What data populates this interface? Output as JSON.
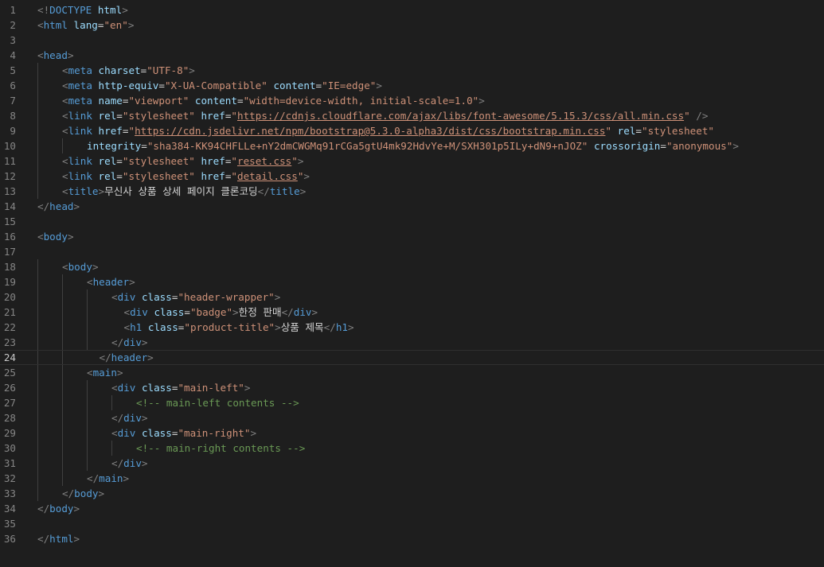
{
  "theme": {
    "background": "#1e1e1e",
    "line_number": "#858585",
    "tag": "#569cd6",
    "attribute": "#9cdcfe",
    "string": "#ce9178",
    "text": "#d4d4d4",
    "comment": "#6a9955",
    "punctuation": "#808080"
  },
  "editor": {
    "active_line": 24,
    "lines": [
      {
        "n": 1,
        "indent": 0,
        "tokens": [
          [
            "p",
            "<!"
          ],
          [
            "t",
            "DOCTYPE"
          ],
          [
            "x",
            " "
          ],
          [
            "a",
            "html"
          ],
          [
            "p",
            ">"
          ]
        ]
      },
      {
        "n": 2,
        "indent": 0,
        "tokens": [
          [
            "p",
            "<"
          ],
          [
            "t",
            "html"
          ],
          [
            "x",
            " "
          ],
          [
            "a",
            "lang"
          ],
          [
            "x",
            "="
          ],
          [
            "s",
            "\"en\""
          ],
          [
            "p",
            ">"
          ]
        ]
      },
      {
        "n": 3,
        "indent": 0,
        "tokens": []
      },
      {
        "n": 4,
        "indent": 0,
        "tokens": [
          [
            "p",
            "<"
          ],
          [
            "t",
            "head"
          ],
          [
            "p",
            ">"
          ]
        ]
      },
      {
        "n": 5,
        "indent": 1,
        "tokens": [
          [
            "p",
            "<"
          ],
          [
            "t",
            "meta"
          ],
          [
            "x",
            " "
          ],
          [
            "a",
            "charset"
          ],
          [
            "x",
            "="
          ],
          [
            "s",
            "\"UTF-8\""
          ],
          [
            "p",
            ">"
          ]
        ]
      },
      {
        "n": 6,
        "indent": 1,
        "tokens": [
          [
            "p",
            "<"
          ],
          [
            "t",
            "meta"
          ],
          [
            "x",
            " "
          ],
          [
            "a",
            "http-equiv"
          ],
          [
            "x",
            "="
          ],
          [
            "s",
            "\"X-UA-Compatible\""
          ],
          [
            "x",
            " "
          ],
          [
            "a",
            "content"
          ],
          [
            "x",
            "="
          ],
          [
            "s",
            "\"IE=edge\""
          ],
          [
            "p",
            ">"
          ]
        ]
      },
      {
        "n": 7,
        "indent": 1,
        "tokens": [
          [
            "p",
            "<"
          ],
          [
            "t",
            "meta"
          ],
          [
            "x",
            " "
          ],
          [
            "a",
            "name"
          ],
          [
            "x",
            "="
          ],
          [
            "s",
            "\"viewport\""
          ],
          [
            "x",
            " "
          ],
          [
            "a",
            "content"
          ],
          [
            "x",
            "="
          ],
          [
            "s",
            "\"width=device-width, initial-scale=1.0\""
          ],
          [
            "p",
            ">"
          ]
        ]
      },
      {
        "n": 8,
        "indent": 1,
        "tokens": [
          [
            "p",
            "<"
          ],
          [
            "t",
            "link"
          ],
          [
            "x",
            " "
          ],
          [
            "a",
            "rel"
          ],
          [
            "x",
            "="
          ],
          [
            "s",
            "\"stylesheet\""
          ],
          [
            "x",
            " "
          ],
          [
            "a",
            "href"
          ],
          [
            "x",
            "="
          ],
          [
            "s",
            "\""
          ],
          [
            "sl",
            "https://cdnjs.cloudflare.com/ajax/libs/font-awesome/5.15.3/css/all.min.css"
          ],
          [
            "s",
            "\""
          ],
          [
            "x",
            " "
          ],
          [
            "p",
            "/>"
          ]
        ]
      },
      {
        "n": 9,
        "indent": 1,
        "tokens": [
          [
            "p",
            "<"
          ],
          [
            "t",
            "link"
          ],
          [
            "x",
            " "
          ],
          [
            "a",
            "href"
          ],
          [
            "x",
            "="
          ],
          [
            "s",
            "\""
          ],
          [
            "sl",
            "https://cdn.jsdelivr.net/npm/bootstrap@5.3.0-alpha3/dist/css/bootstrap.min.css"
          ],
          [
            "s",
            "\""
          ],
          [
            "x",
            " "
          ],
          [
            "a",
            "rel"
          ],
          [
            "x",
            "="
          ],
          [
            "s",
            "\"stylesheet\""
          ]
        ]
      },
      {
        "n": 10,
        "indent": 2,
        "tokens": [
          [
            "a",
            "integrity"
          ],
          [
            "x",
            "="
          ],
          [
            "s",
            "\"sha384-KK94CHFLLe+nY2dmCWGMq91rCGa5gtU4mk92HdvYe+M/SXH301p5ILy+dN9+nJOZ\""
          ],
          [
            "x",
            " "
          ],
          [
            "a",
            "crossorigin"
          ],
          [
            "x",
            "="
          ],
          [
            "s",
            "\"anonymous\""
          ],
          [
            "p",
            ">"
          ]
        ]
      },
      {
        "n": 11,
        "indent": 1,
        "tokens": [
          [
            "p",
            "<"
          ],
          [
            "t",
            "link"
          ],
          [
            "x",
            " "
          ],
          [
            "a",
            "rel"
          ],
          [
            "x",
            "="
          ],
          [
            "s",
            "\"stylesheet\""
          ],
          [
            "x",
            " "
          ],
          [
            "a",
            "href"
          ],
          [
            "x",
            "="
          ],
          [
            "s",
            "\""
          ],
          [
            "sl",
            "reset.css"
          ],
          [
            "s",
            "\""
          ],
          [
            "p",
            ">"
          ]
        ]
      },
      {
        "n": 12,
        "indent": 1,
        "tokens": [
          [
            "p",
            "<"
          ],
          [
            "t",
            "link"
          ],
          [
            "x",
            " "
          ],
          [
            "a",
            "rel"
          ],
          [
            "x",
            "="
          ],
          [
            "s",
            "\"stylesheet\""
          ],
          [
            "x",
            " "
          ],
          [
            "a",
            "href"
          ],
          [
            "x",
            "="
          ],
          [
            "s",
            "\""
          ],
          [
            "sl",
            "detail.css"
          ],
          [
            "s",
            "\""
          ],
          [
            "p",
            ">"
          ]
        ]
      },
      {
        "n": 13,
        "indent": 1,
        "tokens": [
          [
            "p",
            "<"
          ],
          [
            "t",
            "title"
          ],
          [
            "p",
            ">"
          ],
          [
            "x",
            "무신사 상품 상세 페이지 클론코딩"
          ],
          [
            "p",
            "</"
          ],
          [
            "t",
            "title"
          ],
          [
            "p",
            ">"
          ]
        ]
      },
      {
        "n": 14,
        "indent": 0,
        "tokens": [
          [
            "p",
            "</"
          ],
          [
            "t",
            "head"
          ],
          [
            "p",
            ">"
          ]
        ]
      },
      {
        "n": 15,
        "indent": 0,
        "tokens": []
      },
      {
        "n": 16,
        "indent": 0,
        "tokens": [
          [
            "p",
            "<"
          ],
          [
            "t",
            "body"
          ],
          [
            "p",
            ">"
          ]
        ]
      },
      {
        "n": 17,
        "indent": 0,
        "tokens": []
      },
      {
        "n": 18,
        "indent": 1,
        "tokens": [
          [
            "p",
            "<"
          ],
          [
            "t",
            "body"
          ],
          [
            "p",
            ">"
          ]
        ]
      },
      {
        "n": 19,
        "indent": 2,
        "tokens": [
          [
            "p",
            "<"
          ],
          [
            "t",
            "header"
          ],
          [
            "p",
            ">"
          ]
        ]
      },
      {
        "n": 20,
        "indent": 3,
        "tokens": [
          [
            "p",
            "<"
          ],
          [
            "t",
            "div"
          ],
          [
            "x",
            " "
          ],
          [
            "a",
            "class"
          ],
          [
            "x",
            "="
          ],
          [
            "s",
            "\"header-wrapper\""
          ],
          [
            "p",
            ">"
          ]
        ]
      },
      {
        "n": 21,
        "indent": 3.5,
        "tokens": [
          [
            "p",
            "<"
          ],
          [
            "t",
            "div"
          ],
          [
            "x",
            " "
          ],
          [
            "a",
            "class"
          ],
          [
            "x",
            "="
          ],
          [
            "s",
            "\"badge\""
          ],
          [
            "p",
            ">"
          ],
          [
            "x",
            "한정 판매"
          ],
          [
            "p",
            "</"
          ],
          [
            "t",
            "div"
          ],
          [
            "p",
            ">"
          ]
        ]
      },
      {
        "n": 22,
        "indent": 3.5,
        "tokens": [
          [
            "p",
            "<"
          ],
          [
            "t",
            "h1"
          ],
          [
            "x",
            " "
          ],
          [
            "a",
            "class"
          ],
          [
            "x",
            "="
          ],
          [
            "s",
            "\"product-title\""
          ],
          [
            "p",
            ">"
          ],
          [
            "x",
            "상품 제목"
          ],
          [
            "p",
            "</"
          ],
          [
            "t",
            "h1"
          ],
          [
            "p",
            ">"
          ]
        ]
      },
      {
        "n": 23,
        "indent": 3,
        "tokens": [
          [
            "p",
            "</"
          ],
          [
            "t",
            "div"
          ],
          [
            "p",
            ">"
          ]
        ]
      },
      {
        "n": 24,
        "indent": 2.5,
        "tokens": [
          [
            "p",
            "</"
          ],
          [
            "t",
            "header"
          ],
          [
            "p",
            ">"
          ]
        ]
      },
      {
        "n": 25,
        "indent": 2,
        "tokens": [
          [
            "p",
            "<"
          ],
          [
            "t",
            "main"
          ],
          [
            "p",
            ">"
          ]
        ]
      },
      {
        "n": 26,
        "indent": 3,
        "tokens": [
          [
            "p",
            "<"
          ],
          [
            "t",
            "div"
          ],
          [
            "x",
            " "
          ],
          [
            "a",
            "class"
          ],
          [
            "x",
            "="
          ],
          [
            "s",
            "\"main-left\""
          ],
          [
            "p",
            ">"
          ]
        ]
      },
      {
        "n": 27,
        "indent": 4,
        "tokens": [
          [
            "c",
            "<!-- main-left contents -->"
          ]
        ]
      },
      {
        "n": 28,
        "indent": 3,
        "tokens": [
          [
            "p",
            "</"
          ],
          [
            "t",
            "div"
          ],
          [
            "p",
            ">"
          ]
        ]
      },
      {
        "n": 29,
        "indent": 3,
        "tokens": [
          [
            "p",
            "<"
          ],
          [
            "t",
            "div"
          ],
          [
            "x",
            " "
          ],
          [
            "a",
            "class"
          ],
          [
            "x",
            "="
          ],
          [
            "s",
            "\"main-right\""
          ],
          [
            "p",
            ">"
          ]
        ]
      },
      {
        "n": 30,
        "indent": 4,
        "tokens": [
          [
            "c",
            "<!-- main-right contents -->"
          ]
        ]
      },
      {
        "n": 31,
        "indent": 3,
        "tokens": [
          [
            "p",
            "</"
          ],
          [
            "t",
            "div"
          ],
          [
            "p",
            ">"
          ]
        ]
      },
      {
        "n": 32,
        "indent": 2,
        "tokens": [
          [
            "p",
            "</"
          ],
          [
            "t",
            "main"
          ],
          [
            "p",
            ">"
          ]
        ]
      },
      {
        "n": 33,
        "indent": 1,
        "tokens": [
          [
            "p",
            "</"
          ],
          [
            "t",
            "body"
          ],
          [
            "p",
            ">"
          ]
        ]
      },
      {
        "n": 34,
        "indent": 0,
        "tokens": [
          [
            "p",
            "</"
          ],
          [
            "t",
            "body"
          ],
          [
            "p",
            ">"
          ]
        ]
      },
      {
        "n": 35,
        "indent": 0,
        "tokens": []
      },
      {
        "n": 36,
        "indent": 0,
        "tokens": [
          [
            "p",
            "</"
          ],
          [
            "t",
            "html"
          ],
          [
            "p",
            ">"
          ]
        ]
      }
    ]
  }
}
